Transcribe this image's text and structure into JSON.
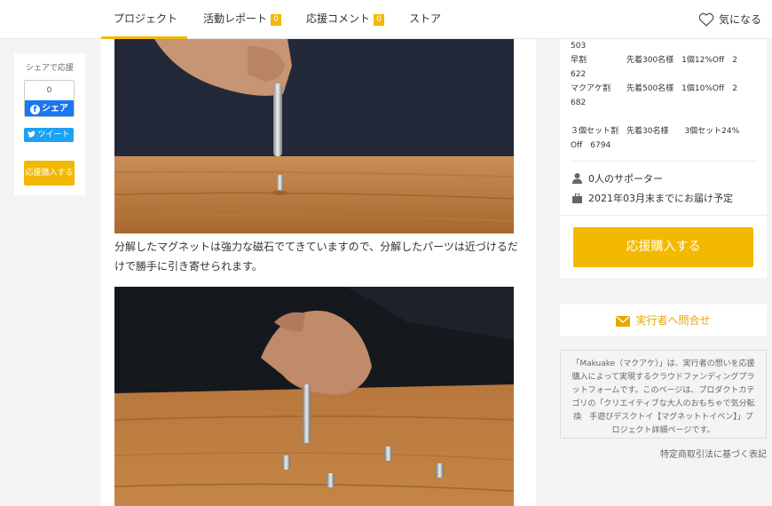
{
  "header": {
    "tabs": [
      {
        "label": "プロジェクト",
        "active": true
      },
      {
        "label": "活動レポート",
        "badge": "0"
      },
      {
        "label": "応援コメント",
        "badge": "0"
      },
      {
        "label": "ストア"
      }
    ],
    "favorite_label": "気になる"
  },
  "share": {
    "title": "シェアで応援",
    "fb_count": "0",
    "fb_label": "シェア",
    "tweet_label": "ツイート",
    "buy_label": "応援購入する"
  },
  "main": {
    "caption": "分解したマグネットは強力な磁石でてきていますので、分解したパーツは近づけるだけで勝手に引き寄せられます。"
  },
  "sidebar": {
    "plan_lines": [
      "503",
      "早割　　　　　先着300名様　1個12%Off　2",
      "622",
      "マクアケ割　　先着500名様　1個10%Off　2",
      "682",
      "",
      "３個セット割　先着30名様　　3個セット24%",
      "Off　6794"
    ],
    "supporters": "0人のサポーター",
    "delivery": "2021年03月末までにお届け予定",
    "buy_label": "応援購入する",
    "contact_label": "実行者へ問合せ",
    "about_text": "「Makuake（マクアケ）」は、実行者の想いを応援購入によって実現するクラウドファンディングプラットフォームです。このページは、プロダクトカテゴリの「クリエイティブな大人のおもちゃで気分転換　手遊びデスクトイ【マグネットトイベン】」プロジェクト詳細ページです。",
    "legal_link": "特定商取引法に基づく表記"
  },
  "colors": {
    "accent": "#f3b800",
    "facebook": "#1877f2",
    "twitter": "#1da1f2"
  }
}
